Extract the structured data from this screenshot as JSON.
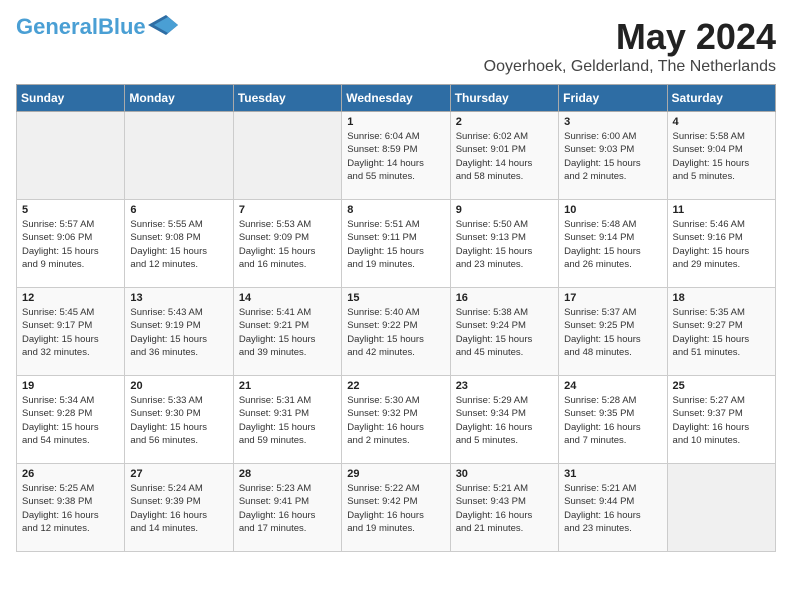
{
  "logo": {
    "part1": "General",
    "part2": "Blue"
  },
  "title": "May 2024",
  "location": "Ooyerhoek, Gelderland, The Netherlands",
  "weekdays": [
    "Sunday",
    "Monday",
    "Tuesday",
    "Wednesday",
    "Thursday",
    "Friday",
    "Saturday"
  ],
  "weeks": [
    [
      {
        "day": "",
        "info": ""
      },
      {
        "day": "",
        "info": ""
      },
      {
        "day": "",
        "info": ""
      },
      {
        "day": "1",
        "info": "Sunrise: 6:04 AM\nSunset: 8:59 PM\nDaylight: 14 hours\nand 55 minutes."
      },
      {
        "day": "2",
        "info": "Sunrise: 6:02 AM\nSunset: 9:01 PM\nDaylight: 14 hours\nand 58 minutes."
      },
      {
        "day": "3",
        "info": "Sunrise: 6:00 AM\nSunset: 9:03 PM\nDaylight: 15 hours\nand 2 minutes."
      },
      {
        "day": "4",
        "info": "Sunrise: 5:58 AM\nSunset: 9:04 PM\nDaylight: 15 hours\nand 5 minutes."
      }
    ],
    [
      {
        "day": "5",
        "info": "Sunrise: 5:57 AM\nSunset: 9:06 PM\nDaylight: 15 hours\nand 9 minutes."
      },
      {
        "day": "6",
        "info": "Sunrise: 5:55 AM\nSunset: 9:08 PM\nDaylight: 15 hours\nand 12 minutes."
      },
      {
        "day": "7",
        "info": "Sunrise: 5:53 AM\nSunset: 9:09 PM\nDaylight: 15 hours\nand 16 minutes."
      },
      {
        "day": "8",
        "info": "Sunrise: 5:51 AM\nSunset: 9:11 PM\nDaylight: 15 hours\nand 19 minutes."
      },
      {
        "day": "9",
        "info": "Sunrise: 5:50 AM\nSunset: 9:13 PM\nDaylight: 15 hours\nand 23 minutes."
      },
      {
        "day": "10",
        "info": "Sunrise: 5:48 AM\nSunset: 9:14 PM\nDaylight: 15 hours\nand 26 minutes."
      },
      {
        "day": "11",
        "info": "Sunrise: 5:46 AM\nSunset: 9:16 PM\nDaylight: 15 hours\nand 29 minutes."
      }
    ],
    [
      {
        "day": "12",
        "info": "Sunrise: 5:45 AM\nSunset: 9:17 PM\nDaylight: 15 hours\nand 32 minutes."
      },
      {
        "day": "13",
        "info": "Sunrise: 5:43 AM\nSunset: 9:19 PM\nDaylight: 15 hours\nand 36 minutes."
      },
      {
        "day": "14",
        "info": "Sunrise: 5:41 AM\nSunset: 9:21 PM\nDaylight: 15 hours\nand 39 minutes."
      },
      {
        "day": "15",
        "info": "Sunrise: 5:40 AM\nSunset: 9:22 PM\nDaylight: 15 hours\nand 42 minutes."
      },
      {
        "day": "16",
        "info": "Sunrise: 5:38 AM\nSunset: 9:24 PM\nDaylight: 15 hours\nand 45 minutes."
      },
      {
        "day": "17",
        "info": "Sunrise: 5:37 AM\nSunset: 9:25 PM\nDaylight: 15 hours\nand 48 minutes."
      },
      {
        "day": "18",
        "info": "Sunrise: 5:35 AM\nSunset: 9:27 PM\nDaylight: 15 hours\nand 51 minutes."
      }
    ],
    [
      {
        "day": "19",
        "info": "Sunrise: 5:34 AM\nSunset: 9:28 PM\nDaylight: 15 hours\nand 54 minutes."
      },
      {
        "day": "20",
        "info": "Sunrise: 5:33 AM\nSunset: 9:30 PM\nDaylight: 15 hours\nand 56 minutes."
      },
      {
        "day": "21",
        "info": "Sunrise: 5:31 AM\nSunset: 9:31 PM\nDaylight: 15 hours\nand 59 minutes."
      },
      {
        "day": "22",
        "info": "Sunrise: 5:30 AM\nSunset: 9:32 PM\nDaylight: 16 hours\nand 2 minutes."
      },
      {
        "day": "23",
        "info": "Sunrise: 5:29 AM\nSunset: 9:34 PM\nDaylight: 16 hours\nand 5 minutes."
      },
      {
        "day": "24",
        "info": "Sunrise: 5:28 AM\nSunset: 9:35 PM\nDaylight: 16 hours\nand 7 minutes."
      },
      {
        "day": "25",
        "info": "Sunrise: 5:27 AM\nSunset: 9:37 PM\nDaylight: 16 hours\nand 10 minutes."
      }
    ],
    [
      {
        "day": "26",
        "info": "Sunrise: 5:25 AM\nSunset: 9:38 PM\nDaylight: 16 hours\nand 12 minutes."
      },
      {
        "day": "27",
        "info": "Sunrise: 5:24 AM\nSunset: 9:39 PM\nDaylight: 16 hours\nand 14 minutes."
      },
      {
        "day": "28",
        "info": "Sunrise: 5:23 AM\nSunset: 9:41 PM\nDaylight: 16 hours\nand 17 minutes."
      },
      {
        "day": "29",
        "info": "Sunrise: 5:22 AM\nSunset: 9:42 PM\nDaylight: 16 hours\nand 19 minutes."
      },
      {
        "day": "30",
        "info": "Sunrise: 5:21 AM\nSunset: 9:43 PM\nDaylight: 16 hours\nand 21 minutes."
      },
      {
        "day": "31",
        "info": "Sunrise: 5:21 AM\nSunset: 9:44 PM\nDaylight: 16 hours\nand 23 minutes."
      },
      {
        "day": "",
        "info": ""
      }
    ]
  ]
}
